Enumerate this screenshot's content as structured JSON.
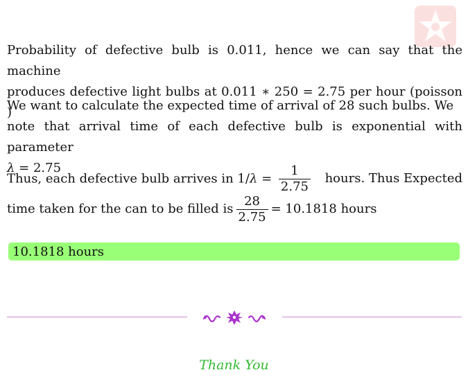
{
  "paragraph1": {
    "line1": "Probability of defective bulb is 0.011, hence we can say that the machine",
    "line2": "produces defective light bulbs at 0.011 ∗ 250 = 2.75 per hour (poisson )"
  },
  "paragraph2": {
    "line1": "We want to calculate the expected time of arrival of 28 such bulbs.  We",
    "line2": "note that arrival time of each defective bulb is exponential with parameter",
    "line3_lambda": "λ",
    "line3_rest": " = 2.75"
  },
  "paragraph3": {
    "part1": "Thus, each defective bulb arrives in 1/",
    "lambda": "λ",
    "eq": " = ",
    "frac1_num": "1",
    "frac1_den": "2.75",
    "part2": "hours.  Thus Expected",
    "part3": "time taken for the can to be filled is",
    "frac2_num": "28",
    "frac2_den": "2.75",
    "part4": "= 10.1818 hours"
  },
  "answer": "10.1818 hours",
  "footer": {
    "thank_you": "Thank You"
  },
  "colors": {
    "answer_bg": "#99ff77",
    "divider": "#cc88cc",
    "ornament": "#aa33cc",
    "thank_you": "#33bb33",
    "logo": "#f4c0c0"
  },
  "icons": {
    "logo": "star-logo-icon",
    "ornament": "floral-ornament-icon"
  }
}
